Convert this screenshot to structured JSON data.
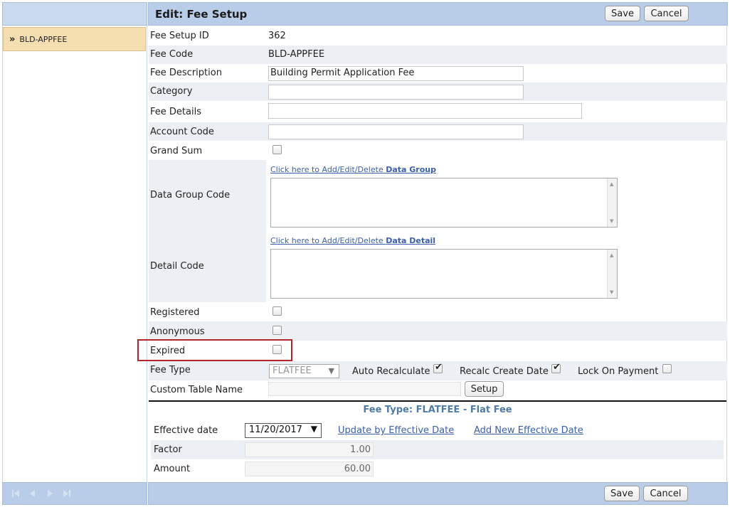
{
  "header": {
    "title": "Edit: Fee Setup",
    "save_label": "Save",
    "cancel_label": "Cancel"
  },
  "footer": {
    "save_label": "Save",
    "cancel_label": "Cancel"
  },
  "sidebar": {
    "items": [
      {
        "label": "BLD-APPFEE",
        "selected": true
      }
    ],
    "nav": [
      "first-icon",
      "prev-icon",
      "next-icon",
      "last-icon"
    ]
  },
  "form": {
    "fee_setup_id": {
      "label": "Fee Setup ID",
      "value": "362"
    },
    "fee_code": {
      "label": "Fee Code",
      "value": "BLD-APPFEE"
    },
    "fee_description": {
      "label": "Fee Description",
      "value": "Building Permit Application Fee"
    },
    "category": {
      "label": "Category",
      "value": ""
    },
    "fee_details": {
      "label": "Fee Details",
      "value": ""
    },
    "account_code": {
      "label": "Account Code",
      "value": ""
    },
    "grand_sum": {
      "label": "Grand Sum",
      "checked": false
    },
    "data_group_code": {
      "label": "Data Group Code",
      "link_prefix": "Click here to Add/Edit/Delete ",
      "link_bold": "Data Group"
    },
    "detail_code": {
      "label": "Detail Code",
      "link_prefix": "Click here to Add/Edit/Delete ",
      "link_bold": "Data Detail"
    },
    "registered": {
      "label": "Registered",
      "checked": false
    },
    "anonymous": {
      "label": "Anonymous",
      "checked": false
    },
    "expired": {
      "label": "Expired",
      "checked": false
    },
    "fee_type": {
      "label": "Fee Type",
      "value": "FLATFEE"
    },
    "auto_recalculate": {
      "label": "Auto Recalculate",
      "checked": true
    },
    "recalc_create_date": {
      "label": "Recalc Create Date",
      "checked": true
    },
    "lock_on_payment": {
      "label": "Lock On Payment",
      "checked": false
    },
    "custom_table_name": {
      "label": "Custom Table Name",
      "value": "",
      "setup_label": "Setup"
    }
  },
  "fee_type_section": {
    "title": "Fee Type: FLATFEE - Flat Fee",
    "effective_date": {
      "label": "Effective date",
      "value": "11/20/2017"
    },
    "update_link": "Update by Effective Date",
    "add_link": "Add New Effective Date",
    "factor": {
      "label": "Factor",
      "value": "1.00"
    },
    "amount": {
      "label": "Amount",
      "value": "60.00"
    }
  },
  "colors": {
    "header_bg": "#b9cde8",
    "selected_item_bg": "#f5deb0",
    "highlight_border": "#b4252a",
    "link": "#3a5fa8"
  }
}
